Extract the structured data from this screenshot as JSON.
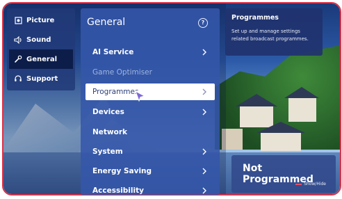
{
  "sidebar": {
    "items": [
      {
        "label": "Picture",
        "icon": "picture-icon"
      },
      {
        "label": "Sound",
        "icon": "speaker-icon"
      },
      {
        "label": "General",
        "icon": "wrench-icon",
        "active": true
      },
      {
        "label": "Support",
        "icon": "headset-icon"
      }
    ]
  },
  "menu": {
    "title": "General",
    "items": [
      {
        "label": "AI Service",
        "arrow": true,
        "state": "normal"
      },
      {
        "label": "Game Optimiser",
        "arrow": false,
        "state": "disabled"
      },
      {
        "label": "Programmes",
        "arrow": true,
        "state": "selected"
      },
      {
        "label": "Devices",
        "arrow": true,
        "state": "normal"
      },
      {
        "label": "Network",
        "arrow": false,
        "state": "normal"
      },
      {
        "label": "System",
        "arrow": true,
        "state": "normal"
      },
      {
        "label": "Energy Saving",
        "arrow": true,
        "state": "normal"
      },
      {
        "label": "Accessibility",
        "arrow": true,
        "state": "normal"
      }
    ]
  },
  "info": {
    "title": "Programmes",
    "description": "Set up and manage settings related broadcast programmes."
  },
  "status": {
    "text": "Not Programmed",
    "show_hide": "Show/Hide"
  },
  "colors": {
    "frame_border": "#d9344a",
    "menu_panel": "#3456aa",
    "selected_bg": "#ffffff",
    "cursor_purple": "#7f6ad6"
  }
}
